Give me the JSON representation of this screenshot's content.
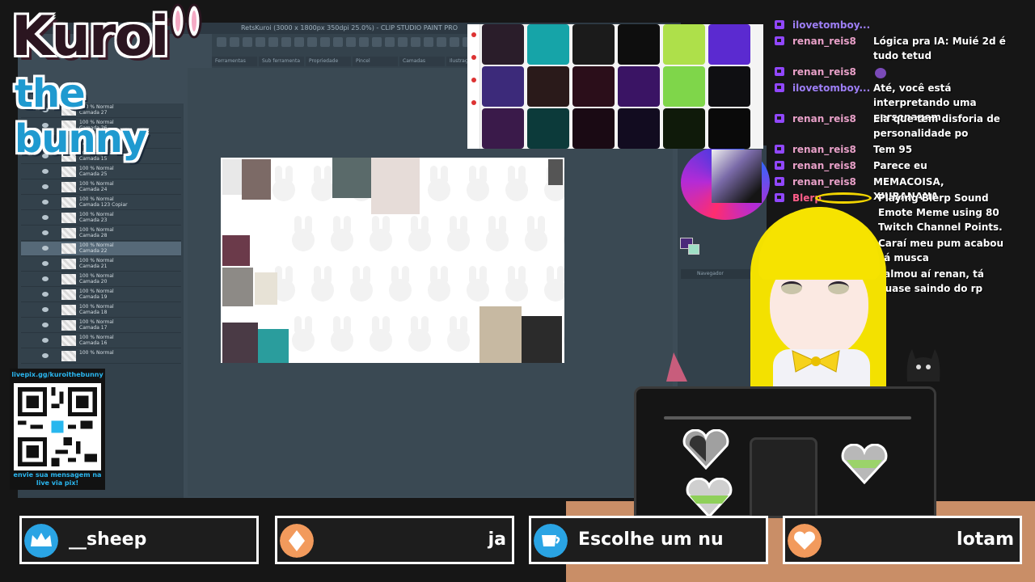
{
  "app": {
    "title": "RetsKuroi (3000 x 1800px 350dpi 25.0%) - CLIP STUDIO PAINT PRO",
    "tabs": [
      "Ferramentas",
      "Sub ferramenta",
      "Propriedade",
      "Pincel",
      "Camadas",
      "Ilustração"
    ],
    "navigator_label": "Navegador",
    "layers": [
      {
        "mode": "100 % Normal",
        "name": "Camada 27"
      },
      {
        "mode": "100 % Normal",
        "name": "Camada 26"
      },
      {
        "mode": "100 % Normal",
        "name": "Camada 14"
      },
      {
        "mode": "100 % Normal",
        "name": "Camada 15"
      },
      {
        "mode": "100 % Normal",
        "name": "Camada 25"
      },
      {
        "mode": "100 % Normal",
        "name": "Camada 24"
      },
      {
        "mode": "100 % Normal",
        "name": "Camada 123 Copiar"
      },
      {
        "mode": "100 % Normal",
        "name": "Camada 23"
      },
      {
        "mode": "100 % Normal",
        "name": "Camada 28"
      },
      {
        "mode": "100 % Normal",
        "name": "Camada 22"
      },
      {
        "mode": "100 % Normal",
        "name": "Camada 21"
      },
      {
        "mode": "100 % Normal",
        "name": "Camada 20"
      },
      {
        "mode": "100 % Normal",
        "name": "Camada 19"
      },
      {
        "mode": "100 % Normal",
        "name": "Camada 18"
      },
      {
        "mode": "100 % Normal",
        "name": "Camada 17"
      },
      {
        "mode": "100 % Normal",
        "name": "Camada 16"
      },
      {
        "mode": "100 % Normal",
        "name": ""
      }
    ],
    "active_layer_index": 9,
    "colors": {
      "foreground": "#4b2a7a",
      "background": "#9fe0c5"
    }
  },
  "logo": {
    "title": "Kuroi",
    "subtitle": "the bunny"
  },
  "qr": {
    "url": "livepix.gg/kuroithebunny",
    "caption": "envie sua mensagem na live via pix!"
  },
  "chat": [
    {
      "user": "ilovetomboy...",
      "text": "",
      "color": "#9d7ef5"
    },
    {
      "user": "renan_reis8",
      "text": "Lógica pra IA: Muié 2d é tudo tetud",
      "color": "#e8a0c8"
    },
    {
      "user": "renan_reis8",
      "text": "",
      "color": "#e8a0c8"
    },
    {
      "user": "ilovetomboy...",
      "text": "Até, você está interpretando uma personagem",
      "color": "#9d7ef5"
    },
    {
      "user": "renan_reis8",
      "text": "Ela que tem disforia de personalidade po",
      "color": "#e8a0c8"
    },
    {
      "user": "renan_reis8",
      "text": "Tem 95",
      "color": "#e8a0c8"
    },
    {
      "user": "renan_reis8",
      "text": "Parece eu",
      "color": "#e8a0c8"
    },
    {
      "user": "renan_reis8",
      "text": "MEMACOISA, XIUBANANA",
      "color": "#e8a0c8"
    },
    {
      "user": "Blerp",
      "text": "Playing Blerp Sound Emote Meme using 80 Twitch Channel Points.",
      "color": "#ff5e8a"
    },
    {
      "user": "",
      "text": "Caraí meu pum acabou cá musca",
      "color": "#e8a0c8"
    },
    {
      "user": "",
      "text": "calmou aí renan, tá quase saindo do rp",
      "color": "#e8a0c8"
    }
  ],
  "alerts": [
    {
      "icon": "crown-icon",
      "text": "__sheep",
      "color": "#2aa4e4"
    },
    {
      "icon": "diamond-icon",
      "text": "ja",
      "color": "#f29a5c"
    },
    {
      "icon": "cup-icon",
      "text": "Escolhe um nu",
      "color": "#2aa4e4"
    },
    {
      "icon": "heart-icon",
      "text": "lotam",
      "color": "#f29a5c"
    }
  ]
}
